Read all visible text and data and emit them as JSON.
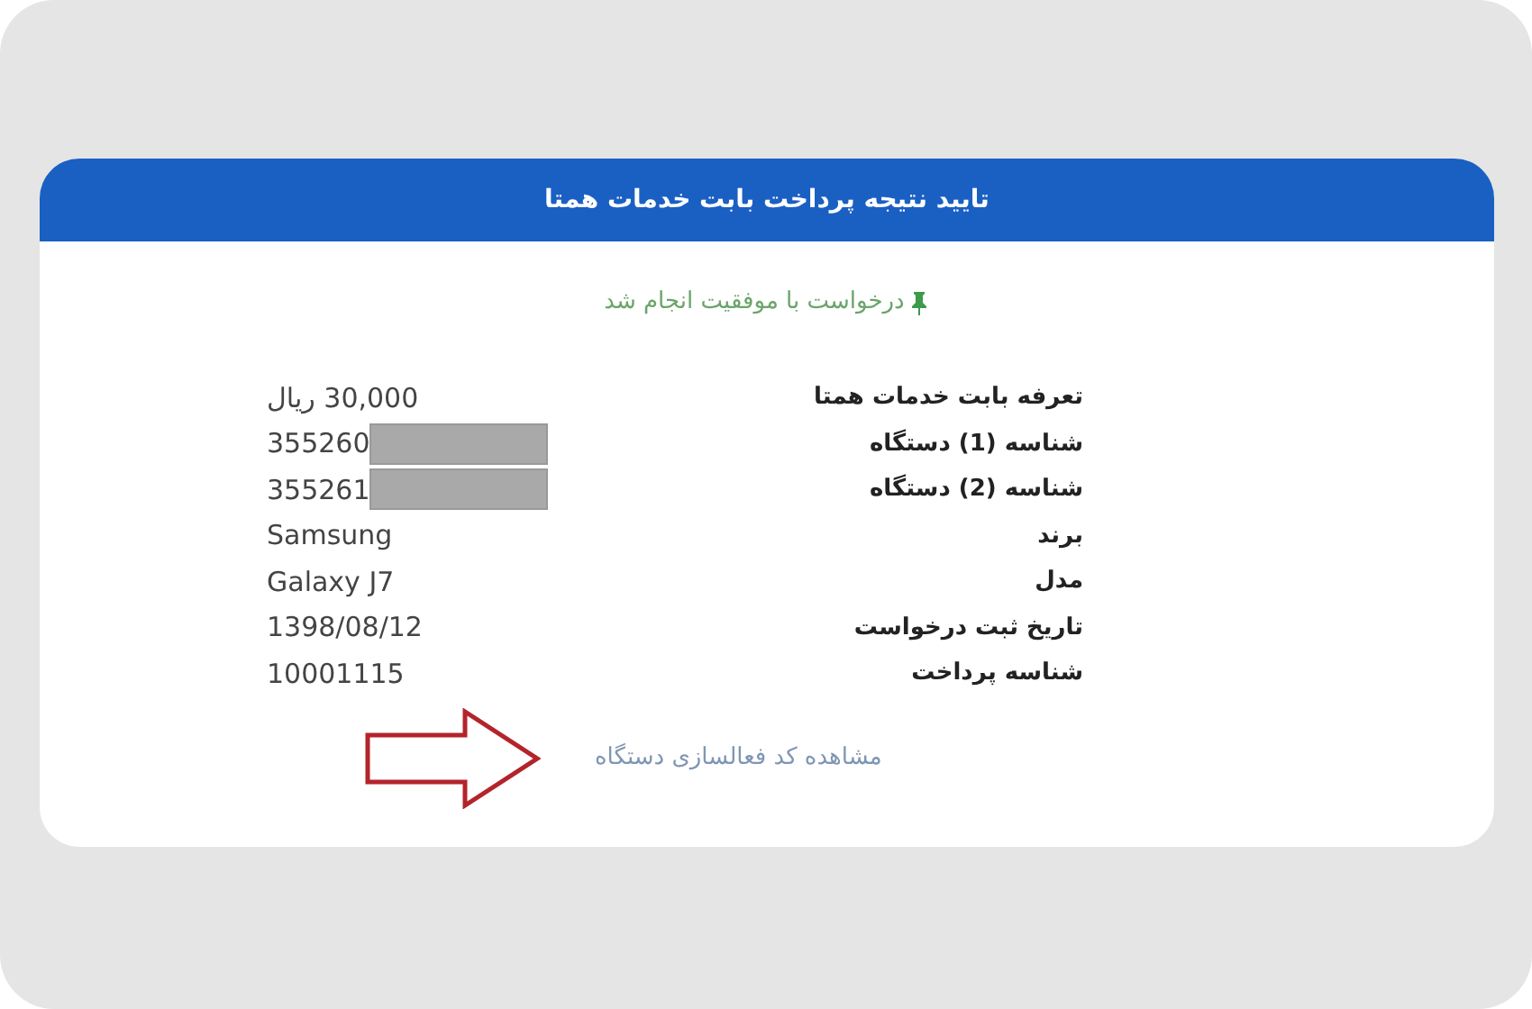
{
  "header": {
    "title": "تایید نتیجه پرداخت بابت خدمات همتا"
  },
  "message": {
    "text": "درخواست با موفقیت انجام شد"
  },
  "details": [
    {
      "label": "تعرفه بابت خدمات همتا",
      "value": "30,000 ریال",
      "redacted": false
    },
    {
      "label": "شناسه (1) دستگاه",
      "value": "355260",
      "redacted": true
    },
    {
      "label": "شناسه (2) دستگاه",
      "value": "355261",
      "redacted": true
    },
    {
      "label": "برند",
      "value": "Samsung",
      "redacted": false
    },
    {
      "label": "مدل",
      "value": "Galaxy J7",
      "redacted": false
    },
    {
      "label": "تاریخ ثبت درخواست",
      "value": "1398/08/12",
      "redacted": false
    },
    {
      "label": "شناسه پرداخت",
      "value": "10001115",
      "redacted": false
    }
  ],
  "link": {
    "text": "مشاهده کد فعالسازی دستگاه"
  }
}
